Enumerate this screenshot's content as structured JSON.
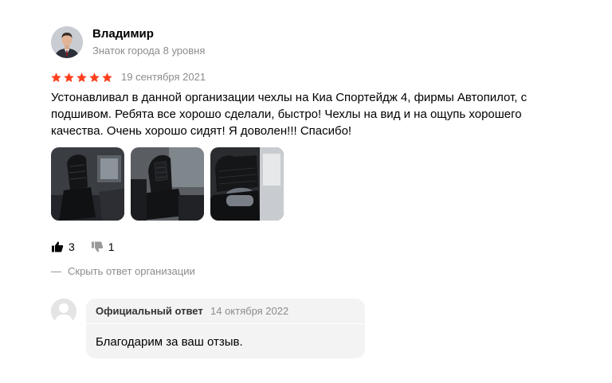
{
  "author": {
    "name": "Владимир",
    "level": "Знаток города 8 уровня"
  },
  "rating": {
    "stars": 5,
    "max": 5,
    "color": "#fc3f1d"
  },
  "review": {
    "date": "19 сентября 2021",
    "text": "Устонавливал в данной организации чехлы на Киа Спортейдж 4, фирмы Автопилот, с подшивом. Ребята все хорошо сделали, быстро! Чехлы на вид и на ощупь хорошего качества. Очень хорошо сидят! Я доволен!!! Спасибо!",
    "photo_count": 3
  },
  "reactions": {
    "likes": "3",
    "dislikes": "1",
    "like_icon": "thumbs-up-icon",
    "dislike_icon": "thumbs-down-icon"
  },
  "org_reply": {
    "toggle_dash": "—",
    "toggle_label": "Скрыть ответ организации",
    "label": "Официальный ответ",
    "date": "14 октября 2022",
    "text": "Благодарим за ваш отзыв."
  }
}
